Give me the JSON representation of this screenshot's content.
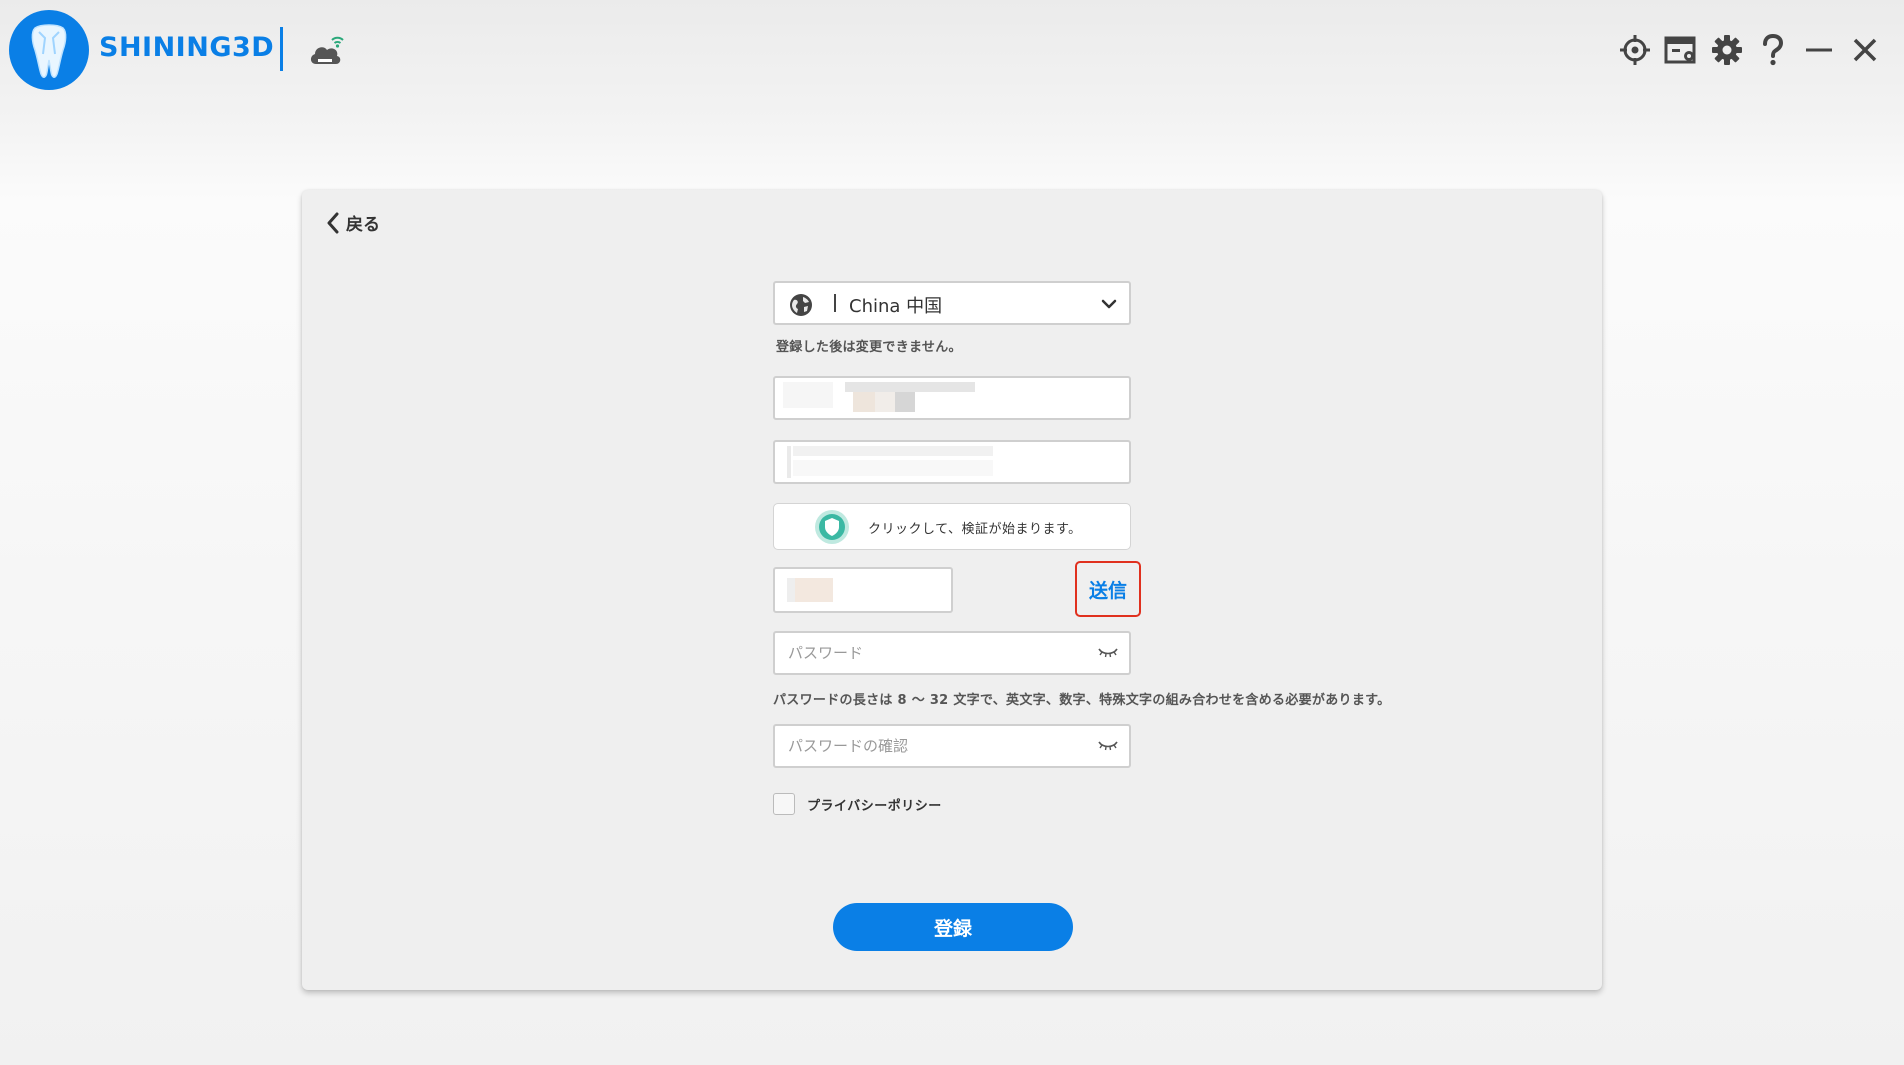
{
  "header": {
    "brand": "SHINING3D",
    "icons": [
      "tooth-logo-icon",
      "cloud-wifi-icon",
      "crosshair-icon",
      "window-icon",
      "gear-icon",
      "help-icon",
      "minimize-icon",
      "close-icon"
    ]
  },
  "form": {
    "back_label": "戻る",
    "country_value": "China 中国",
    "country_hint": "登録した後は変更できません。",
    "captcha_label": "クリックして、検証が始まります。",
    "send_label": "送信",
    "password_placeholder": "パスワード",
    "password_hint": "パスワードの長さは 8 ～ 32 文字で、英文字、数字、特殊文字の組み合わせを含める必要があります。",
    "confirm_placeholder": "パスワードの確認",
    "privacy_label": "プライバシーポリシー",
    "register_label": "登録"
  },
  "colors": {
    "accent": "#0a7fe6",
    "highlight": "#e0301e",
    "captcha_green": "#3bb8a3"
  }
}
